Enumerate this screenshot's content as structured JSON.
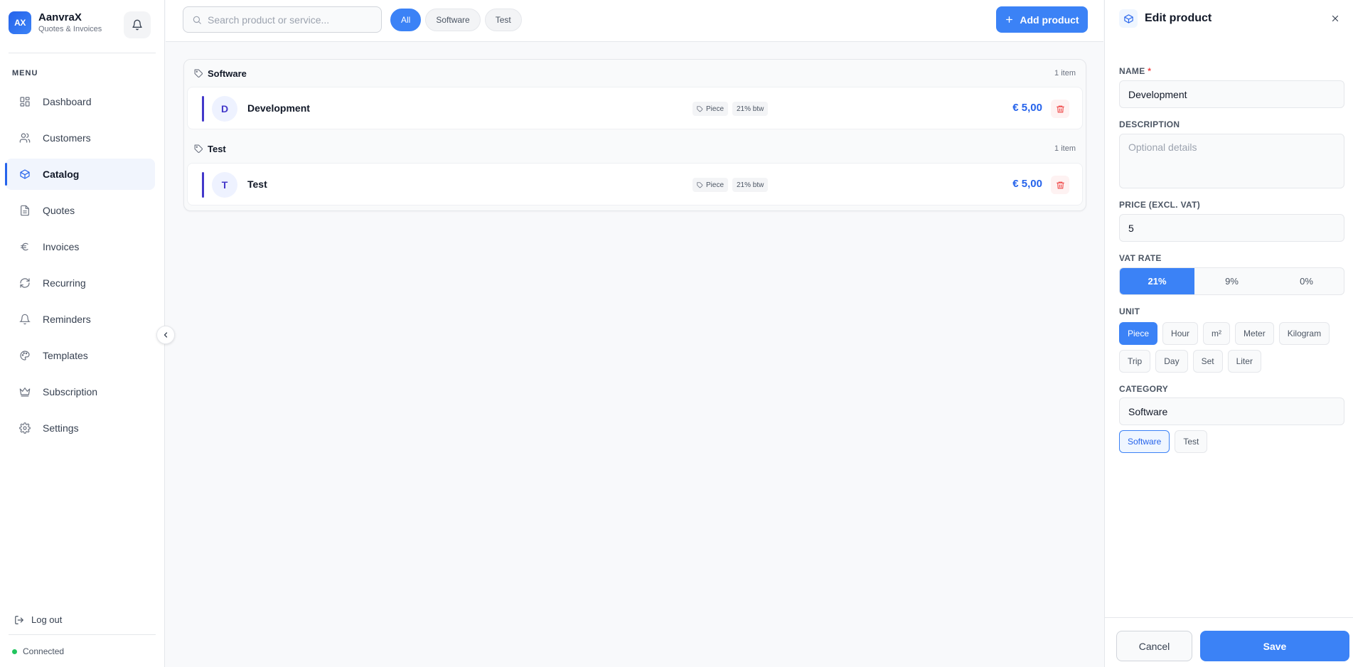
{
  "app": {
    "name": "AanvraX",
    "subtitle": "Quotes & Invoices",
    "logo_text": "AX"
  },
  "sidebar": {
    "menu_title": "MENU",
    "items": [
      {
        "label": "Dashboard",
        "icon": "dashboard-icon"
      },
      {
        "label": "Customers",
        "icon": "users-icon"
      },
      {
        "label": "Catalog",
        "icon": "box-icon",
        "active": true
      },
      {
        "label": "Quotes",
        "icon": "document-icon"
      },
      {
        "label": "Invoices",
        "icon": "euro-icon"
      },
      {
        "label": "Recurring",
        "icon": "refresh-icon"
      },
      {
        "label": "Reminders",
        "icon": "bell-icon"
      },
      {
        "label": "Templates",
        "icon": "palette-icon"
      },
      {
        "label": "Subscription",
        "icon": "crown-icon"
      },
      {
        "label": "Settings",
        "icon": "gear-icon"
      }
    ],
    "logout_label": "Log out",
    "status_label": "Connected"
  },
  "topbar": {
    "search_placeholder": "Search product or service...",
    "filters": [
      {
        "label": "All",
        "active": true
      },
      {
        "label": "Software"
      },
      {
        "label": "Test"
      }
    ],
    "add_label": "Add product"
  },
  "catalog": {
    "groups": [
      {
        "name": "Software",
        "count": "1 item",
        "items": [
          {
            "initial": "D",
            "name": "Development",
            "unit": "Piece",
            "vat": "21% btw",
            "price": "€ 5,00"
          }
        ]
      },
      {
        "name": "Test",
        "count": "1 item",
        "items": [
          {
            "initial": "T",
            "name": "Test",
            "unit": "Piece",
            "vat": "21% btw",
            "price": "€ 5,00"
          }
        ]
      }
    ]
  },
  "panel": {
    "title": "Edit product",
    "name_label": "NAME",
    "required_mark": "*",
    "name_value": "Development",
    "description_label": "DESCRIPTION",
    "description_placeholder": "Optional details",
    "price_label": "PRICE (EXCL. VAT)",
    "price_value": "5",
    "vat_label": "VAT RATE",
    "vat_options": [
      "21%",
      "9%",
      "0%"
    ],
    "vat_selected": "21%",
    "unit_label": "UNIT",
    "unit_options": [
      "Piece",
      "Hour",
      "m²",
      "Meter",
      "Kilogram",
      "Trip",
      "Day",
      "Set",
      "Liter"
    ],
    "unit_selected": "Piece",
    "category_label": "CATEGORY",
    "category_value": "Software",
    "category_options": [
      "Software",
      "Test"
    ],
    "category_selected": "Software",
    "cancel_label": "Cancel",
    "save_label": "Save"
  },
  "colors": {
    "accent": "#3b82f6",
    "price": "#2563eb",
    "status_ok": "#22c55e",
    "danger": "#ef4444",
    "row_accent": "#4338ca"
  }
}
